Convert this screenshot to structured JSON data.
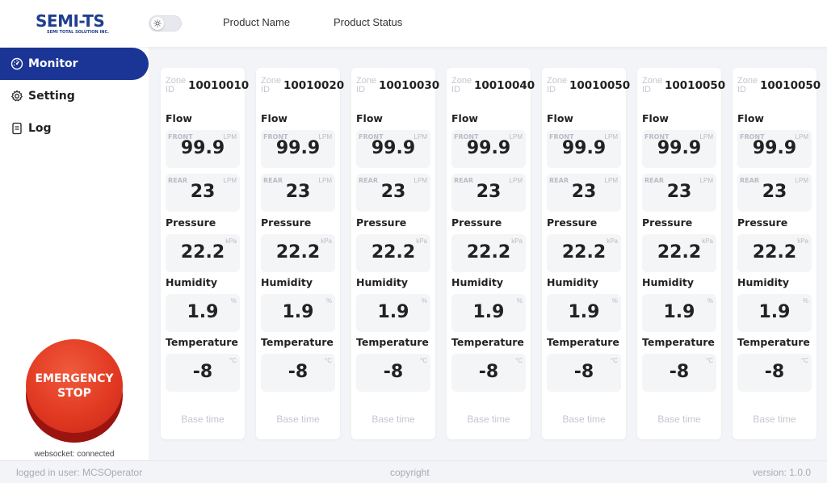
{
  "header": {
    "logo_text": "SEMI-TS",
    "logo_subtext": "SEMI TOTAL SOLUTION INC.",
    "theme_toggle_icon": "sun-icon",
    "nav": [
      "Product Name",
      "Product Status"
    ]
  },
  "sidebar": {
    "items": [
      {
        "label": "Monitor",
        "icon": "dashboard-icon",
        "active": true
      },
      {
        "label": "Setting",
        "icon": "gear-icon",
        "active": false
      },
      {
        "label": "Log",
        "icon": "document-icon",
        "active": false
      }
    ],
    "emergency_line1": "EMERGENCY",
    "emergency_line2": "STOP",
    "websocket_status": "websocket: connected"
  },
  "labels": {
    "zone": "Zone ID",
    "flow": "Flow",
    "front": "FRONT",
    "rear": "REAR",
    "pressure": "Pressure",
    "humidity": "Humidity",
    "temperature": "Temperature",
    "unit_flow": "LPM",
    "unit_pressure": "kPa",
    "unit_humidity": "%",
    "unit_temperature": "°C"
  },
  "zones": [
    {
      "id": "10010010",
      "flow_front": "99.9",
      "flow_rear": "23",
      "pressure": "22.2",
      "humidity": "1.9",
      "temperature": "-8",
      "base_time": "Base time"
    },
    {
      "id": "10010020",
      "flow_front": "99.9",
      "flow_rear": "23",
      "pressure": "22.2",
      "humidity": "1.9",
      "temperature": "-8",
      "base_time": "Base time"
    },
    {
      "id": "10010030",
      "flow_front": "99.9",
      "flow_rear": "23",
      "pressure": "22.2",
      "humidity": "1.9",
      "temperature": "-8",
      "base_time": "Base time"
    },
    {
      "id": "10010040",
      "flow_front": "99.9",
      "flow_rear": "23",
      "pressure": "22.2",
      "humidity": "1.9",
      "temperature": "-8",
      "base_time": "Base time"
    },
    {
      "id": "10010050",
      "flow_front": "99.9",
      "flow_rear": "23",
      "pressure": "22.2",
      "humidity": "1.9",
      "temperature": "-8",
      "base_time": "Base time"
    },
    {
      "id": "10010050",
      "flow_front": "99.9",
      "flow_rear": "23",
      "pressure": "22.2",
      "humidity": "1.9",
      "temperature": "-8",
      "base_time": "Base time"
    },
    {
      "id": "10010050",
      "flow_front": "99.9",
      "flow_rear": "23",
      "pressure": "22.2",
      "humidity": "1.9",
      "temperature": "-8",
      "base_time": "Base time"
    }
  ],
  "footer": {
    "user": "logged in user: MCSOperator",
    "copyright": "copyright",
    "version": "version: 1.0.0"
  },
  "colors": {
    "brand": "#1f3e8f",
    "active_nav": "#1a3595",
    "emergency": "#e23a22"
  }
}
